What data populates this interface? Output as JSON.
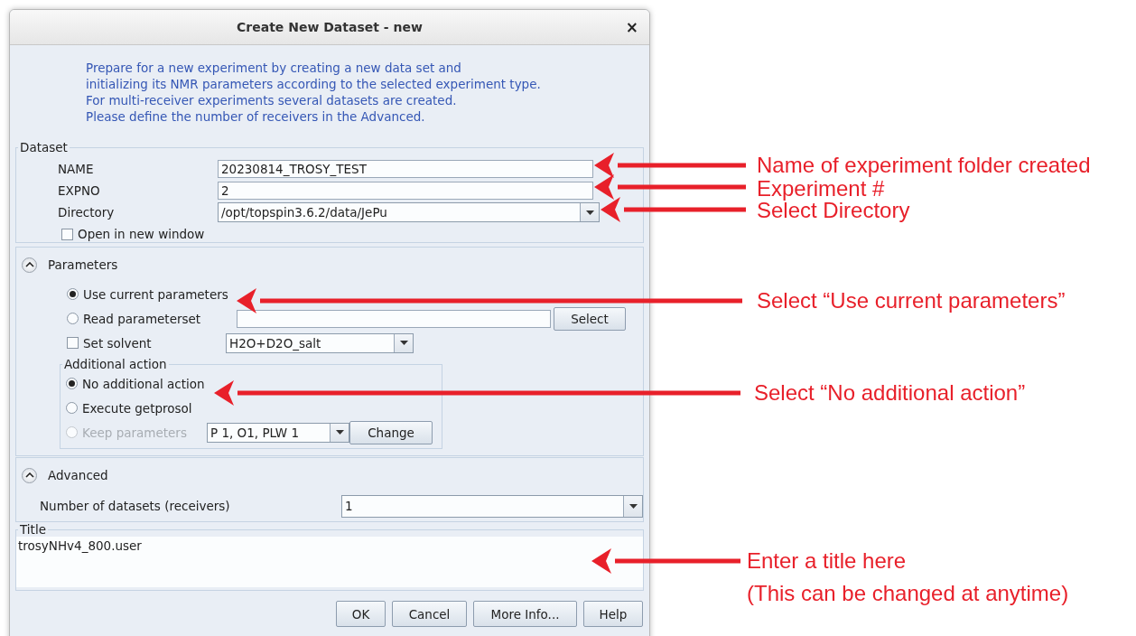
{
  "window": {
    "title": "Create New Dataset - new",
    "close": "×"
  },
  "intro": "Prepare for a new experiment by creating a new data set and\ninitializing its NMR parameters according to the selected experiment type.\nFor multi-receiver experiments several datasets are created.\nPlease define the number of receivers in the Advanced.",
  "dataset": {
    "legend": "Dataset",
    "fields": [
      {
        "kind": "text",
        "label": "NAME",
        "value": "20230814_TROSY_TEST"
      },
      {
        "kind": "text",
        "label": "EXPNO",
        "value": "2"
      },
      {
        "kind": "combo",
        "label": "Directory",
        "value": "/opt/topspin3.6.2/data/JePu"
      }
    ],
    "open_in_new_window": {
      "label": "Open in new window",
      "checked": false
    }
  },
  "parameters": {
    "header": "Parameters",
    "expanded": true,
    "options": [
      {
        "kind": "radio",
        "label": "Use current parameters",
        "selected": true
      },
      {
        "kind": "radio_field",
        "label": "Read parameterset",
        "selected": false,
        "button": "Select"
      },
      {
        "kind": "checkbox_combo",
        "label": "Set solvent",
        "checked": false,
        "value": "H2O+D2O_salt"
      }
    ],
    "additional_action": {
      "legend": "Additional action",
      "options": [
        {
          "label": "No additional action",
          "selected": true,
          "disabled": false
        },
        {
          "label": "Execute getprosol",
          "selected": false,
          "disabled": false
        },
        {
          "label": "Keep parameters",
          "selected": false,
          "disabled": true,
          "value": "P 1, O1, PLW 1",
          "button": "Change"
        }
      ]
    }
  },
  "advanced": {
    "header": "Advanced",
    "expanded": true,
    "label": "Number of datasets (receivers)",
    "value": "1"
  },
  "title_box": {
    "legend": "Title",
    "value": "trosyNHv4_800.user"
  },
  "buttons": [
    {
      "label": "OK"
    },
    {
      "label": "Cancel"
    },
    {
      "label": "More Info..."
    },
    {
      "label": "Help"
    }
  ],
  "annotations": [
    {
      "lines": [
        "Name of experiment folder created"
      ]
    },
    {
      "lines": [
        "Experiment #"
      ]
    },
    {
      "lines": [
        "Select Directory"
      ]
    },
    {
      "lines": [
        "Select “Use current parameters”"
      ]
    },
    {
      "lines": [
        "Select “No additional action”"
      ]
    },
    {
      "lines": [
        "Enter a title here",
        "(This can be changed at anytime)"
      ]
    }
  ]
}
